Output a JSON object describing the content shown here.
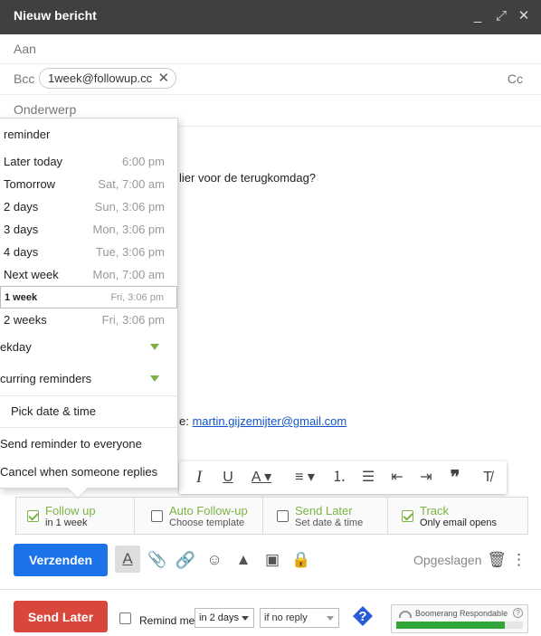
{
  "window": {
    "title": "Nieuw bericht",
    "minimize": "_",
    "maximize": "⤢",
    "close": "✕"
  },
  "fields": {
    "to_label": "Aan",
    "bcc_label": "Bcc",
    "bcc_chip": "1week@followup.cc",
    "cc_label": "Cc",
    "subject_placeholder": "Onderwerp"
  },
  "body": {
    "line1": "lier voor de terugkomdag?",
    "link_prefix": "e: ",
    "link": "martin.gijzemijter@gmail.com"
  },
  "reminder_menu": {
    "header": "reminder",
    "options": [
      {
        "label": "Later today",
        "time": "6:00 pm"
      },
      {
        "label": "Tomorrow",
        "time": "Sat, 7:00 am"
      },
      {
        "label": "2 days",
        "time": "Sun, 3:06 pm"
      },
      {
        "label": "3 days",
        "time": "Mon, 3:06 pm"
      },
      {
        "label": "4 days",
        "time": "Tue, 3:06 pm"
      },
      {
        "label": "Next week",
        "time": "Mon, 7:00 am"
      },
      {
        "label": "1 week",
        "time": "Fri, 3:06 pm",
        "selected": true
      },
      {
        "label": "2 weeks",
        "time": "Fri, 3:06 pm"
      }
    ],
    "weekday": "ekday",
    "recurring": "curring reminders",
    "pick": "Pick date & time",
    "send_all": "Send reminder to everyone",
    "cancel_reply": "Cancel when someone replies"
  },
  "boomerang_options": [
    {
      "title": "Follow up",
      "sub": "in 1 week",
      "checked": true
    },
    {
      "title": "Auto Follow-up",
      "sub": "Choose template",
      "checked": false
    },
    {
      "title": "Send Later",
      "sub": "Set date & time",
      "checked": false
    },
    {
      "title": "Track",
      "sub": "Only email opens",
      "checked": true
    }
  ],
  "toolbar": {
    "send": "Verzenden",
    "saved": "Opgeslagen"
  },
  "boomerang_bar": {
    "send_later": "Send Later",
    "remind_me": "Remind me",
    "when": "in 2 days",
    "condition": "if no reply",
    "help": "?",
    "respondable_label": "Boomerang Respondable",
    "respondable_level": 0.86
  },
  "colors": {
    "send_blue": "#1a73e8",
    "send_later_red": "#d9463b",
    "boomerang_green": "#7cb342"
  }
}
